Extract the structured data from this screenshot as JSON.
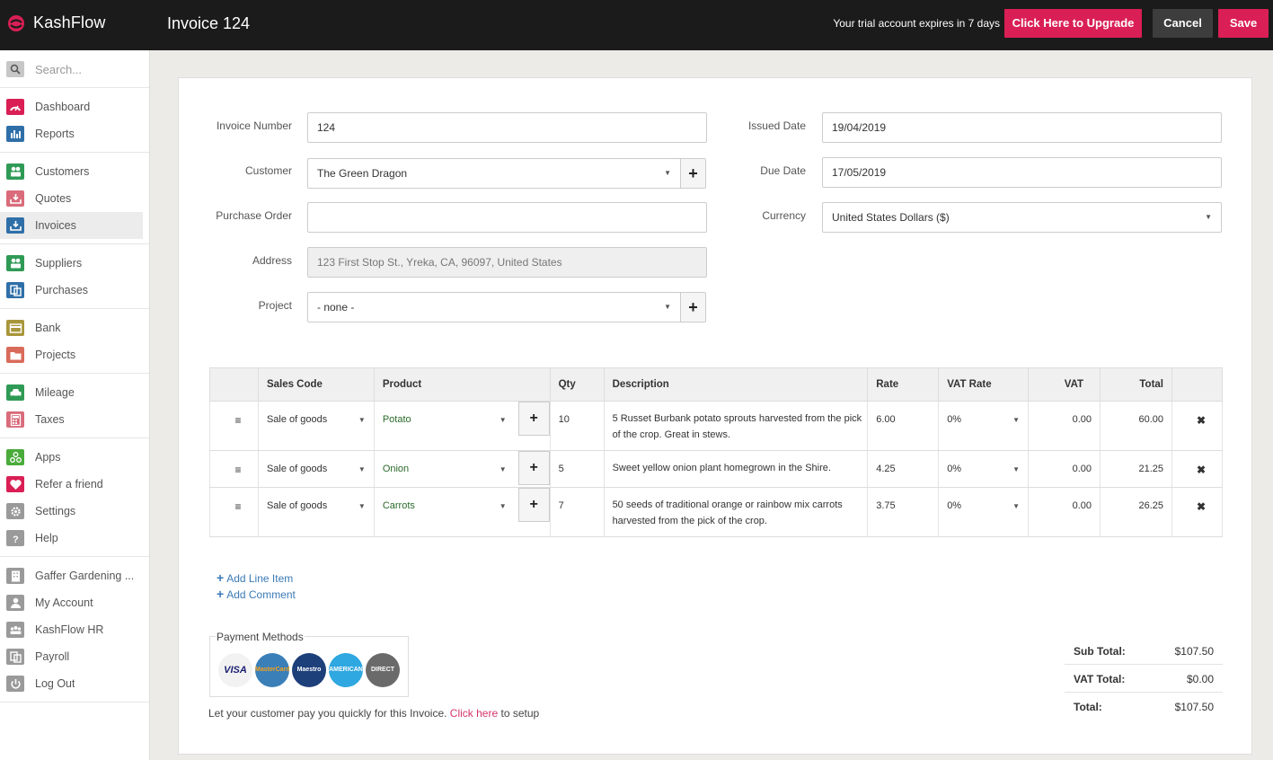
{
  "app": {
    "name": "KashFlow"
  },
  "header": {
    "title": "Invoice 124",
    "trial_text": "Your trial account expires in 7 days",
    "upgrade_label": "Click Here to Upgrade",
    "cancel_label": "Cancel",
    "save_label": "Save"
  },
  "sidebar": {
    "search_placeholder": "Search...",
    "items": [
      {
        "label": "Dashboard",
        "icon": "gauge-icon",
        "color": "#d91f55"
      },
      {
        "label": "Reports",
        "icon": "bar-chart-icon",
        "color": "#2f6fa8"
      },
      {
        "label": "Customers",
        "icon": "users-icon",
        "color": "#2f9a55"
      },
      {
        "label": "Quotes",
        "icon": "inbox-icon",
        "color": "#d96b7a"
      },
      {
        "label": "Invoices",
        "icon": "inbox-icon",
        "color": "#2f6fa8"
      },
      {
        "label": "Suppliers",
        "icon": "users-icon",
        "color": "#2f9a55"
      },
      {
        "label": "Purchases",
        "icon": "copy-icon",
        "color": "#2f6fa8"
      },
      {
        "label": "Bank",
        "icon": "card-icon",
        "color": "#a8963a"
      },
      {
        "label": "Projects",
        "icon": "folder-icon",
        "color": "#d96b5a"
      },
      {
        "label": "Mileage",
        "icon": "car-icon",
        "color": "#2f9a55"
      },
      {
        "label": "Taxes",
        "icon": "calculator-icon",
        "color": "#d96b7a"
      },
      {
        "label": "Apps",
        "icon": "apps-icon",
        "color": "#4aab3a"
      },
      {
        "label": "Refer a friend",
        "icon": "heart-icon",
        "color": "#d91f55"
      },
      {
        "label": "Settings",
        "icon": "gear-icon",
        "color": "#9a9a9a"
      },
      {
        "label": "Help",
        "icon": "question-icon",
        "color": "#9a9a9a"
      },
      {
        "label": "Gaffer Gardening ...",
        "icon": "building-icon",
        "color": "#9a9a9a"
      },
      {
        "label": "My Account",
        "icon": "user-icon",
        "color": "#9a9a9a"
      },
      {
        "label": "KashFlow HR",
        "icon": "team-icon",
        "color": "#9a9a9a"
      },
      {
        "label": "Payroll",
        "icon": "copy-icon",
        "color": "#9a9a9a"
      },
      {
        "label": "Log Out",
        "icon": "power-icon",
        "color": "#9a9a9a"
      }
    ]
  },
  "form": {
    "invoice_number": {
      "label": "Invoice Number",
      "value": "124"
    },
    "customer": {
      "label": "Customer",
      "value": "The Green Dragon"
    },
    "purchase_order": {
      "label": "Purchase Order",
      "value": ""
    },
    "address": {
      "label": "Address",
      "value": "123 First Stop St., Yreka, CA,  96097, United States"
    },
    "project": {
      "label": "Project",
      "value": "- none -"
    },
    "issued_date": {
      "label": "Issued Date",
      "value": "19/04/2019"
    },
    "due_date": {
      "label": "Due Date",
      "value": "17/05/2019"
    },
    "currency": {
      "label": "Currency",
      "value": "United States Dollars ($)"
    }
  },
  "table": {
    "headers": [
      "Sales Code",
      "Product",
      "Qty",
      "Description",
      "Rate",
      "VAT Rate",
      "VAT",
      "Total"
    ],
    "rows": [
      {
        "sales_code": "Sale of goods",
        "product": "Potato",
        "qty": "10",
        "description": "5 Russet Burbank potato sprouts harvested from the pick of the crop. Great in stews.",
        "rate": "6.00",
        "vat_rate": "0%",
        "vat": "0.00",
        "total": "60.00"
      },
      {
        "sales_code": "Sale of goods",
        "product": "Onion",
        "qty": "5",
        "description": "Sweet yellow onion plant homegrown in the Shire.",
        "rate": "4.25",
        "vat_rate": "0%",
        "vat": "0.00",
        "total": "21.25"
      },
      {
        "sales_code": "Sale of goods",
        "product": "Carrots",
        "qty": "7",
        "description": "50 seeds of traditional orange or rainbow mix carrots harvested from the pick of the crop.",
        "rate": "3.75",
        "vat_rate": "0%",
        "vat": "0.00",
        "total": "26.25"
      }
    ]
  },
  "actions": {
    "add_line_item": "Add Line Item",
    "add_comment": "Add Comment"
  },
  "payment": {
    "title": "Payment Methods",
    "note_before": "Let your customer pay you quickly for this Invoice. ",
    "note_link": "Click here",
    "note_after": " to setup",
    "methods": [
      {
        "name": "VISA",
        "color": "#f2f2f2",
        "text_color": "#1a1f71"
      },
      {
        "name": "MasterCard",
        "color": "#3b7fb8",
        "text_color": "#f7a21b"
      },
      {
        "name": "Maestro",
        "color": "#1d3f7a",
        "text_color": "#ffffff"
      },
      {
        "name": "AMERICAN EXPRESS",
        "color": "#2fa7e0",
        "text_color": "#ffffff"
      },
      {
        "name": "DIRECT DEBIT",
        "color": "#6a6a6a",
        "text_color": "#ffffff"
      }
    ]
  },
  "totals": {
    "sub_total_label": "Sub Total:",
    "sub_total": "$107.50",
    "vat_total_label": "VAT Total:",
    "vat_total": "$0.00",
    "total_label": "Total:",
    "total": "$107.50"
  }
}
